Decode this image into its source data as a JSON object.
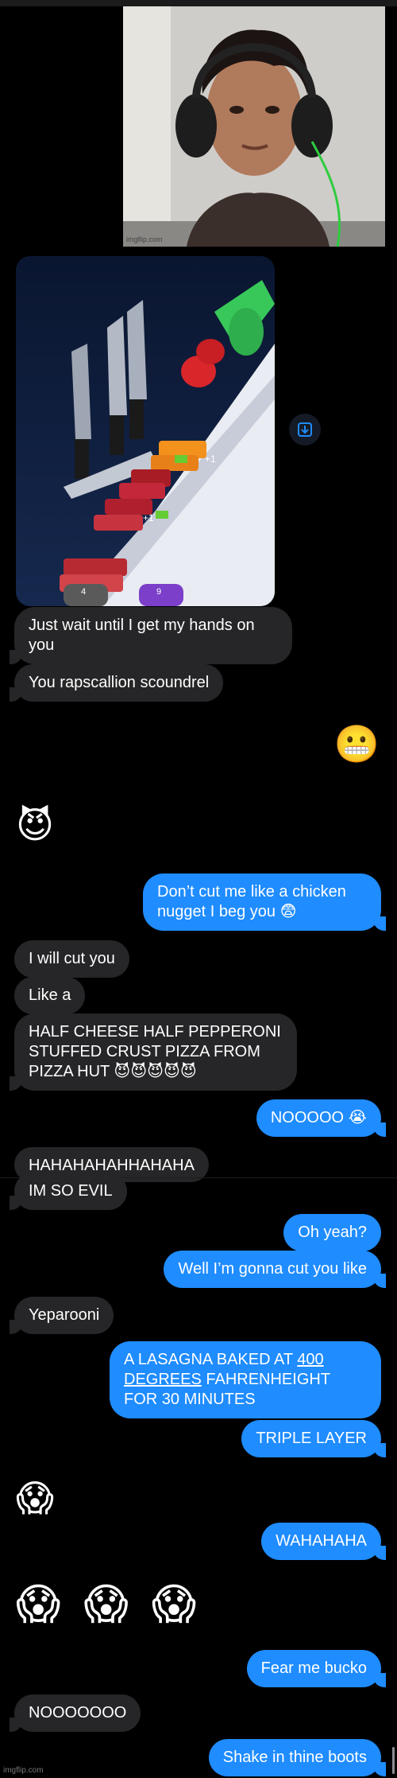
{
  "photo": {
    "watermark": "imgflip.com"
  },
  "game": {
    "badge_left": "4",
    "badge_right": "9",
    "bonus_labels": [
      "+1",
      "+1"
    ]
  },
  "messages": {
    "m1": "Just wait until I get my hands on you",
    "m2": "You rapscallion scoundrel",
    "e1": "😬",
    "e2": "😈",
    "m3": "Don’t cut me like a chicken nugget I beg you 😨",
    "m4": "I will cut you",
    "m5": "Like a",
    "m6": "HALF CHEESE HALF PEPPERONI STUFFED CRUST PIZZA FROM PIZZA HUT 😈😈😈😈😈",
    "m7": "NOOOOO 😭",
    "m8": "HAHAHAHAHHAHAHA",
    "m9": "IM SO EVIL",
    "m10": "Oh yeah?",
    "m11": "Well I’m gonna cut you like",
    "m12": "Yeparooni",
    "m13_a": "A LASAGNA BAKED AT ",
    "m13_b": "400",
    "m13_c": " ",
    "m13_d": "DEGREES",
    "m13_e": " FAHRENHEIGHT FOR 30 MINUTES",
    "m14": "TRIPLE LAYER",
    "e3": "😱",
    "m15": "WAHAHAHA",
    "e4": "😱 😱 😱",
    "m16": "Fear me bucko",
    "m17": "NOOOOOOO",
    "m18": "Shake in thine boots"
  },
  "footer": {
    "watermark": "imgflip.com"
  },
  "colors": {
    "sent": "#1f8cff",
    "received": "#262628",
    "background": "#000000"
  }
}
